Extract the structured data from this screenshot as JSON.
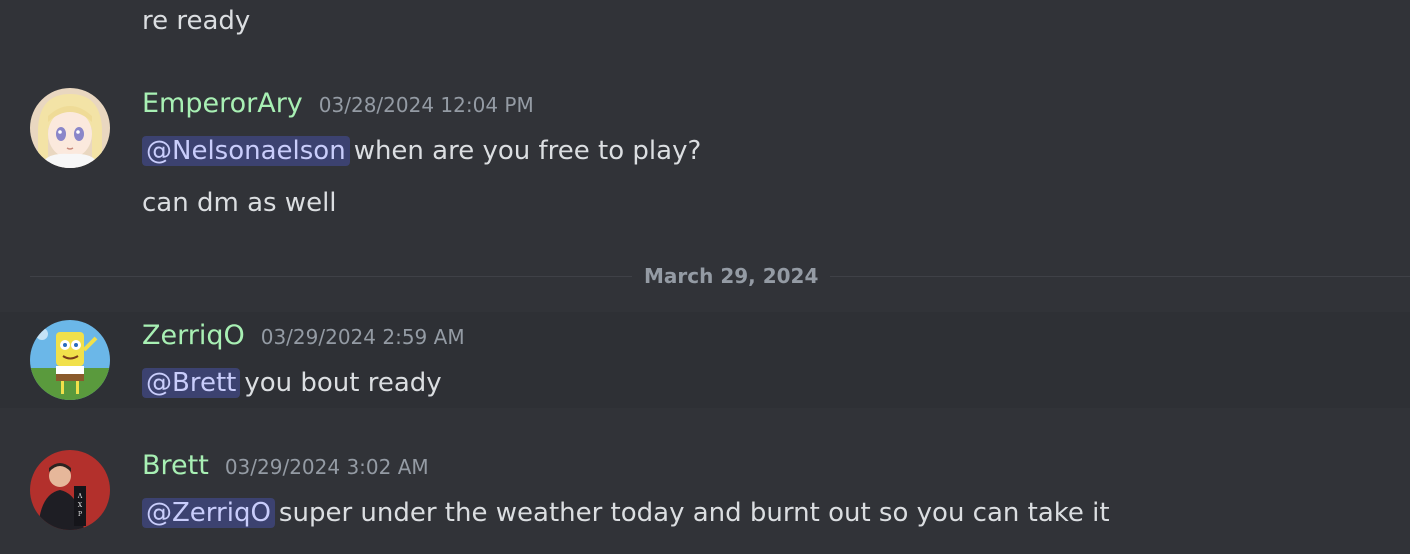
{
  "messages": {
    "prev_fragment": "re ready",
    "group1": {
      "avatar_icon": "anime-girl-avatar",
      "username": "EmperorAry",
      "timestamp": "03/28/2024 12:04 PM",
      "line1_mention": "@Nelsonaelson",
      "line1_text": "when are you free to play?",
      "line2_text": "can dm as well"
    },
    "date_divider": "March 29, 2024",
    "group2": {
      "avatar_icon": "spongebob-avatar",
      "username": "ZerriqO",
      "timestamp": "03/29/2024 2:59 AM",
      "mention": "@Brett",
      "text": "you bout ready"
    },
    "group3": {
      "avatar_icon": "man-portrait-avatar",
      "username": "Brett",
      "timestamp": "03/29/2024 3:02 AM",
      "mention": "@ZerriqO",
      "text": "super under the weather today and burnt out so you can take it"
    }
  },
  "colors": {
    "background": "#313338",
    "username": "#a8f0b4",
    "timestamp": "#949ba4",
    "mention_bg": "#3c4270",
    "mention_text": "#c9cdfb"
  }
}
